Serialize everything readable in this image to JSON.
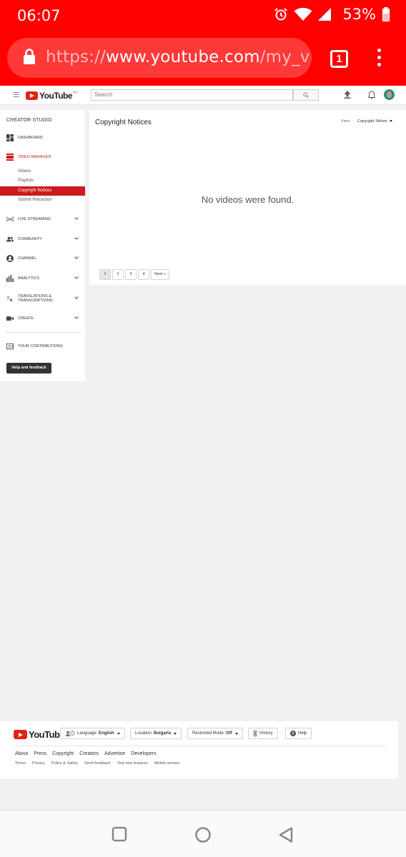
{
  "status_bar": {
    "time": "06:07",
    "battery": "53%"
  },
  "browser": {
    "url_scheme": "https://",
    "url_host": "www.youtube.com",
    "url_path": "/my_vid",
    "tab_count": "1"
  },
  "masthead": {
    "logo_text": "YouTube",
    "country_code": "BG",
    "search_placeholder": "Search"
  },
  "sidebar": {
    "title": "CREATOR STUDIO",
    "dashboard": "DASHBOARD",
    "video_manager": "VIDEO MANAGER",
    "sub_items": [
      "Videos",
      "Playlists",
      "Copyright Notices",
      "Submit Retraction"
    ],
    "live_streaming": "LIVE STREAMING",
    "community": "COMMUNITY",
    "channel": "CHANNEL",
    "analytics": "ANALYTICS",
    "translations_1": "TRANSLATIONS &",
    "translations_2": "TRANSCRIPTIONS",
    "create": "CREATE",
    "contributions": "YOUR CONTRIBUTIONS",
    "help_button": "Help and feedback"
  },
  "main": {
    "title": "Copyright Notices",
    "view_label": "View:",
    "view_value": "Copyright Strikes",
    "empty_message": "No videos were found.",
    "pages": [
      "1",
      "2",
      "3",
      "4"
    ],
    "next_label": "Next »"
  },
  "footer": {
    "logo_text": "YouTube",
    "language_label": "Language:",
    "language_value": "English",
    "location_label": "Location:",
    "location_value": "Bulgaria",
    "restricted_label": "Restricted Mode:",
    "restricted_value": "Off",
    "history": "History",
    "help": "Help",
    "links_primary": [
      "About",
      "Press",
      "Copyright",
      "Creators",
      "Advertise",
      "Developers"
    ],
    "links_secondary": [
      "Terms",
      "Privacy",
      "Policy & Safety",
      "Send feedback",
      "Test new features",
      "Mobile version"
    ]
  },
  "colors": {
    "youtube_red": "#ff0000",
    "accent_red": "#cc181e",
    "page_bg": "#f1f1f1"
  },
  "icons": [
    "alarm-icon",
    "wifi-icon",
    "signal-icon",
    "battery-icon",
    "lock-icon",
    "menu-icon",
    "search-icon",
    "upload-icon",
    "bell-icon",
    "dashboard-icon",
    "video-manager-icon",
    "live-icon",
    "community-icon",
    "channel-icon",
    "analytics-icon",
    "translate-icon",
    "create-icon",
    "contributions-icon",
    "history-icon",
    "help-icon"
  ]
}
